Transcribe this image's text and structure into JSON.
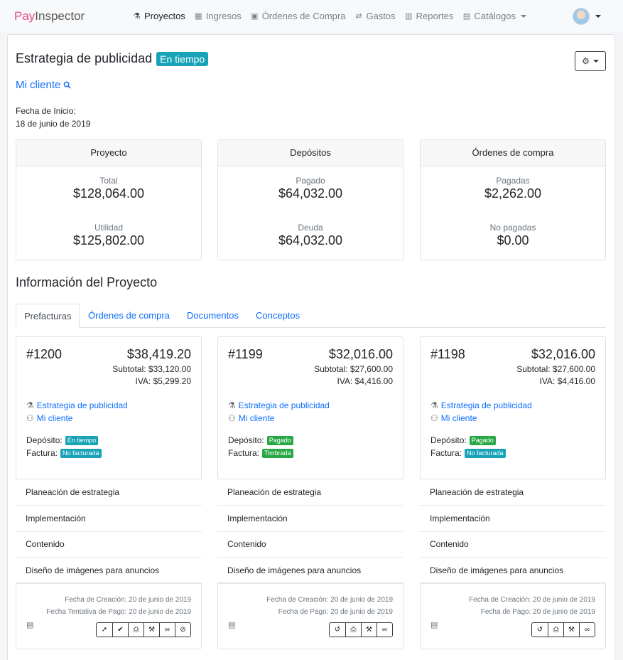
{
  "brand": {
    "part1": "Pay",
    "part2": "Inspector"
  },
  "nav": [
    {
      "label": "Proyectos",
      "icon": "flask-icon",
      "glyph": "⚗"
    },
    {
      "label": "Ingresos",
      "icon": "table-icon",
      "glyph": "▦"
    },
    {
      "label": "Órdenes de Compra",
      "icon": "briefcase-icon",
      "glyph": "▣"
    },
    {
      "label": "Gastos",
      "icon": "exchange-icon",
      "glyph": "⇄"
    },
    {
      "label": "Reportes",
      "icon": "bar-chart-icon",
      "glyph": "▥"
    },
    {
      "label": "Catálogos",
      "icon": "list-icon",
      "glyph": "▤"
    }
  ],
  "project": {
    "title": "Estrategia de publicidad",
    "status": "En tiempo",
    "client": "Mi cliente",
    "start_label": "Fecha de Inicio:",
    "start_value": "18 de junio de 2019"
  },
  "summary": [
    {
      "header": "Proyecto",
      "l1": "Total",
      "v1": "$128,064.00",
      "l2": "Utilidad",
      "v2": "$125,802.00"
    },
    {
      "header": "Depósitos",
      "l1": "Pagado",
      "v1": "$64,032.00",
      "l2": "Deuda",
      "v2": "$64,032.00"
    },
    {
      "header": "Órdenes de compra",
      "l1": "Pagadas",
      "v1": "$2,262.00",
      "l2": "No pagadas",
      "v2": "$0.00"
    }
  ],
  "section_title": "Información del Proyecto",
  "tabs": [
    "Prefacturas",
    "Órdenes de compra",
    "Documentos",
    "Conceptos"
  ],
  "invoices": [
    {
      "number": "#1200",
      "total": "$38,419.20",
      "subtotal": "Subtotal: $33,120.00",
      "iva": "IVA: $5,299.20",
      "project": "Estrategia de publicidad",
      "client": "Mi cliente",
      "deposit_label": "Depósito:",
      "deposit": "En tiempo",
      "deposit_color": "#17a2b8",
      "invoice_label": "Factura:",
      "invoice": "No facturada",
      "invoice_color": "#17a2b8",
      "items": [
        "Planeación de estrategia",
        "Implementación",
        "Contenido",
        "Diseño de imágenes para anuncios"
      ],
      "date1": "Fecha de Creación: 20 de junio de 2019",
      "date2": "Fecha Tentativa de Pago: 20 de junio de 2019",
      "actions": [
        "rocket-icon",
        "check-circle-icon",
        "print-icon",
        "gavel-icon",
        "link-icon",
        "ban-icon"
      ]
    },
    {
      "number": "#1199",
      "total": "$32,016.00",
      "subtotal": "Subtotal: $27,600.00",
      "iva": "IVA: $4,416.00",
      "project": "Estrategia de publicidad",
      "client": "Mi cliente",
      "deposit_label": "Depósito:",
      "deposit": "Pagado",
      "deposit_color": "#28a745",
      "invoice_label": "Factura:",
      "invoice": "Timbrada",
      "invoice_color": "#28a745",
      "items": [
        "Planeación de estrategia",
        "Implementación",
        "Contenido",
        "Diseño de imágenes para anuncios"
      ],
      "date1": "Fecha de Creación: 20 de junio de 2019",
      "date2": "Fecha de Pago: 20 de junio de 2019",
      "actions": [
        "undo-icon",
        "print-icon",
        "gavel-icon",
        "link-icon"
      ]
    },
    {
      "number": "#1198",
      "total": "$32,016.00",
      "subtotal": "Subtotal: $27,600.00",
      "iva": "IVA: $4,416.00",
      "project": "Estrategia de publicidad",
      "client": "Mi cliente",
      "deposit_label": "Depósito:",
      "deposit": "Pagado",
      "deposit_color": "#28a745",
      "invoice_label": "Factura:",
      "invoice": "No facturada",
      "invoice_color": "#17a2b8",
      "items": [
        "Planeación de estrategia",
        "Implementación",
        "Contenido",
        "Diseño de imágenes para anuncios"
      ],
      "date1": "Fecha de Creación: 20 de junio de 2019",
      "date2": "Fecha de Pago: 20 de junio de 2019",
      "actions": [
        "undo-icon",
        "print-icon",
        "gavel-icon",
        "link-icon"
      ]
    }
  ]
}
